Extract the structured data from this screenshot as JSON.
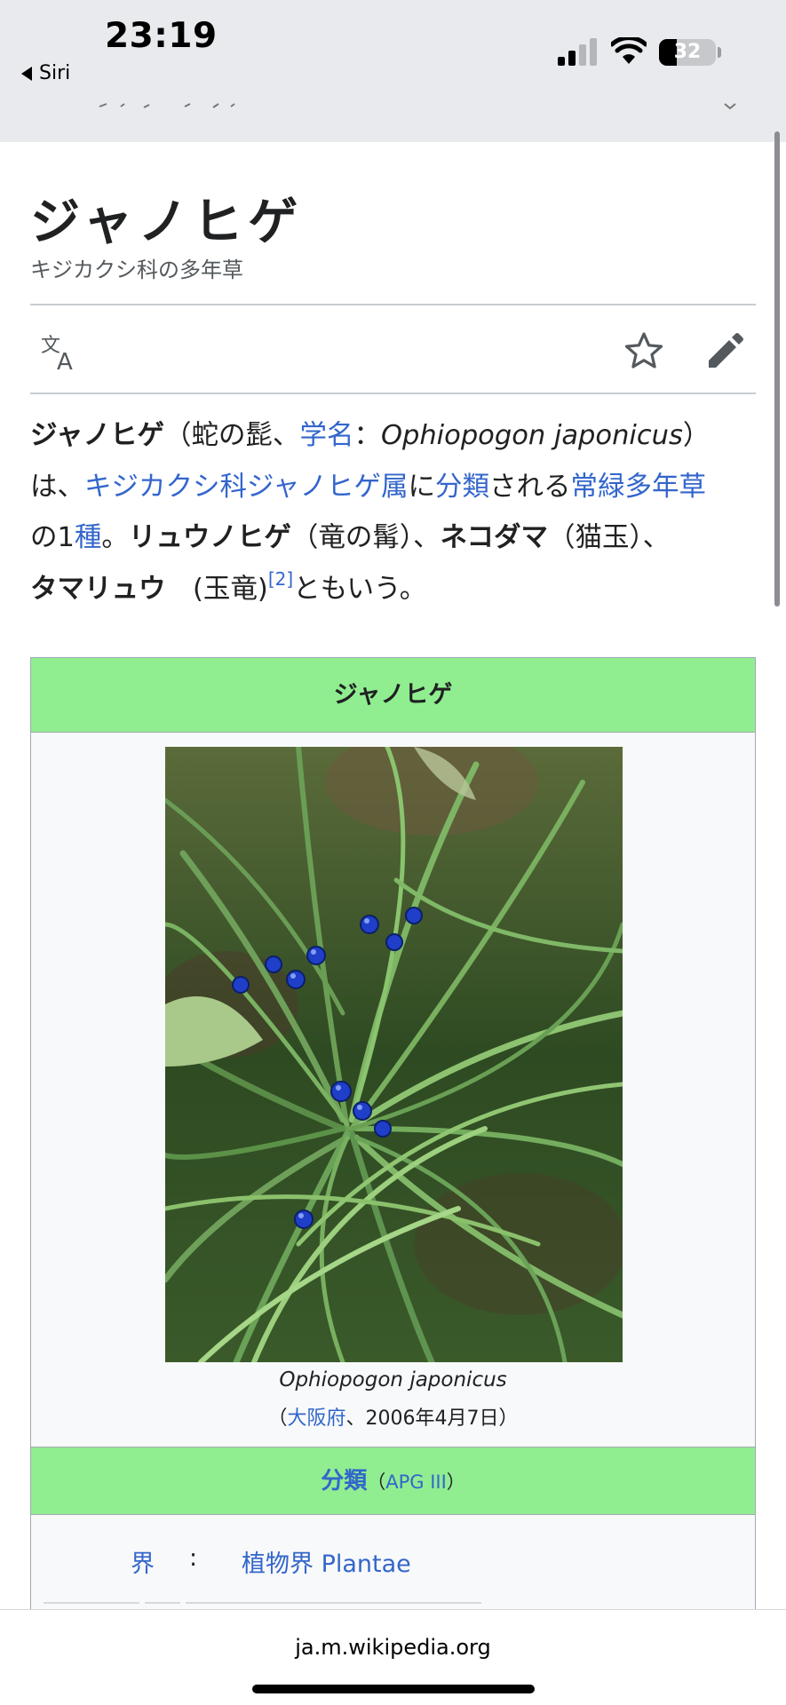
{
  "status_bar": {
    "time": "23:19",
    "back_label": "Siri",
    "battery_level": 32,
    "battery_text": "32",
    "signal_bars_active": 2,
    "signal_bars_total": 4
  },
  "article": {
    "title": "ジャノヒゲ",
    "subtitle": "キジカクシ科の多年草",
    "toolbar": {
      "language_icon": "translate-icon",
      "watch_icon": "star-icon",
      "edit_icon": "pencil-icon"
    },
    "lead": {
      "t1": "ジャノヒゲ",
      "t2": "（蛇の髭、",
      "link_gakumei": "学名",
      "t3": "：",
      "t4": "Ophiopogon japonicus",
      "t5": "）は、",
      "link_genus": "キジカクシ科ジャノヒゲ属",
      "t6": "に",
      "link_bunrui": "分類",
      "t7": "される",
      "link_perennial": "常緑多年草",
      "t8": "の1",
      "link_species": "種",
      "t9": "。",
      "t10": "リュウノヒゲ",
      "t11": "（竜の髯）、",
      "t12": "ネコダマ",
      "t13": "（猫玉）、",
      "t14": "タマリュウ",
      "t15": "　(玉竜)",
      "ref": "[2]",
      "t16": "ともいう。"
    },
    "infobox": {
      "header": "ジャノヒゲ",
      "image_alt": "Ophiopogon japonicus photo",
      "caption_italic": "Ophiopogon japonicus",
      "caption_open": "（",
      "caption_link": "大阪府",
      "caption_rest": "、2006年4月7日）",
      "classification_label": "分類",
      "classification_open": "（",
      "classification_system": "APG III",
      "classification_close": "）",
      "taxonomy": [
        {
          "rank": "界",
          "sep": ":",
          "name": "植物界 Plantae"
        }
      ]
    }
  },
  "browser": {
    "url": "ja.m.wikipedia.org"
  },
  "colors": {
    "link": "#3366cc",
    "infobox_header": "#90ee90",
    "status_bg": "#e9eaee"
  }
}
